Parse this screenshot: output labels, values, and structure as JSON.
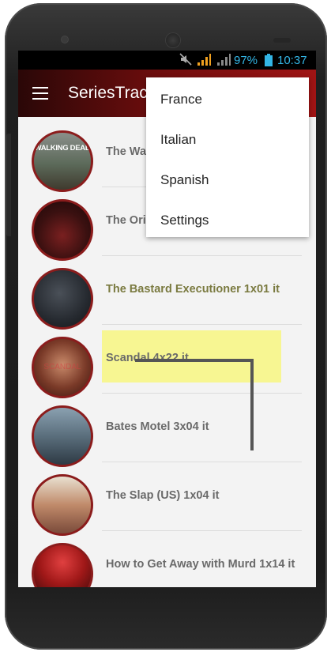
{
  "status_bar": {
    "battery": "97%",
    "time": "10:37"
  },
  "app_bar": {
    "title": "SeriesTrac"
  },
  "menu": {
    "items": [
      {
        "label": "France"
      },
      {
        "label": "Italian"
      },
      {
        "label": "Spanish"
      },
      {
        "label": "Settings"
      }
    ]
  },
  "series": [
    {
      "title": "The Wal"
    },
    {
      "title": "The Orig"
    },
    {
      "title": "The Bastard Executioner 1x01 it"
    },
    {
      "title": "Scandal 4x22 it"
    },
    {
      "title": "Bates Motel 3x04 it"
    },
    {
      "title": "The Slap (US) 1x04 it"
    },
    {
      "title": "How to Get Away with Murd 1x14 it"
    }
  ],
  "thumbnail_text": {
    "walking_dead_logo": "WALKING DEAD",
    "scandal_overlay": "SCANDAL"
  },
  "colors": {
    "status_text": "#33b5e5",
    "app_bar": "#8b1414",
    "highlight": "#f7f58c",
    "thumb_border": "#8b1c1c"
  }
}
